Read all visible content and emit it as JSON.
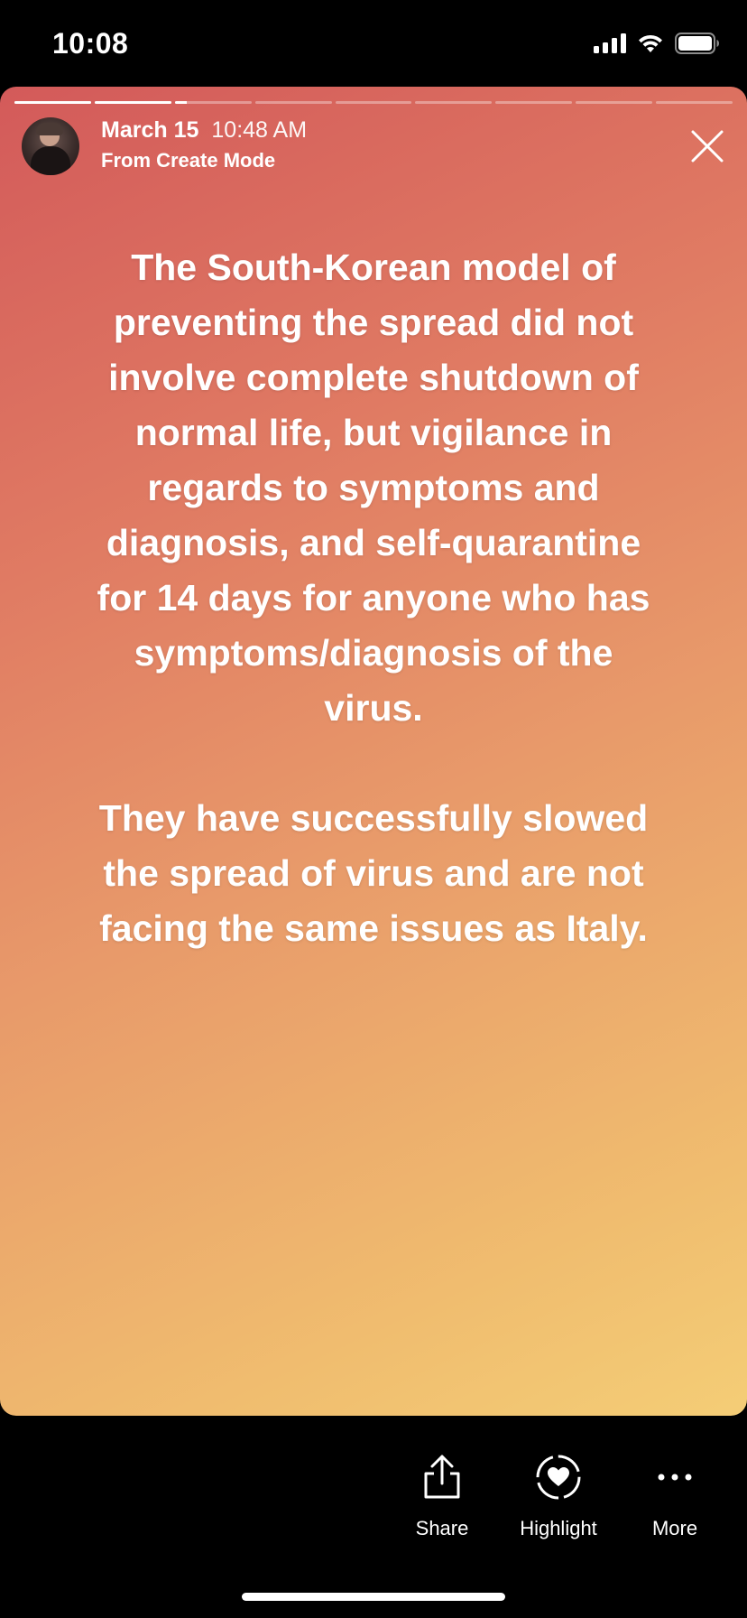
{
  "status_bar": {
    "time": "10:08",
    "icons": [
      "cellular-signal-icon",
      "wifi-icon",
      "battery-icon"
    ]
  },
  "story": {
    "progress_segments": [
      1,
      1,
      0.15,
      0,
      0,
      0,
      0,
      0,
      0
    ],
    "header": {
      "date": "March 15",
      "time": "10:48 AM",
      "source": "From Create Mode"
    },
    "text": {
      "paragraph_1_lines": [
        "The South-Korean model of",
        "preventing the spread did not",
        "involve complete shutdown of",
        "normal life, but vigilance in",
        "regards to symptoms and",
        "diagnosis, and self-quarantine",
        "for 14 days for anyone who has",
        "symptoms/diagnosis of the",
        "virus."
      ],
      "paragraph_2_lines": [
        "They have successfully slowed",
        "the spread of virus and are not",
        "facing the same issues as Italy."
      ]
    },
    "gradient_colors": [
      "#d35a5a",
      "#e89a6a",
      "#f4cd76"
    ]
  },
  "toolbar": {
    "share_label": "Share",
    "highlight_label": "Highlight",
    "more_label": "More"
  }
}
